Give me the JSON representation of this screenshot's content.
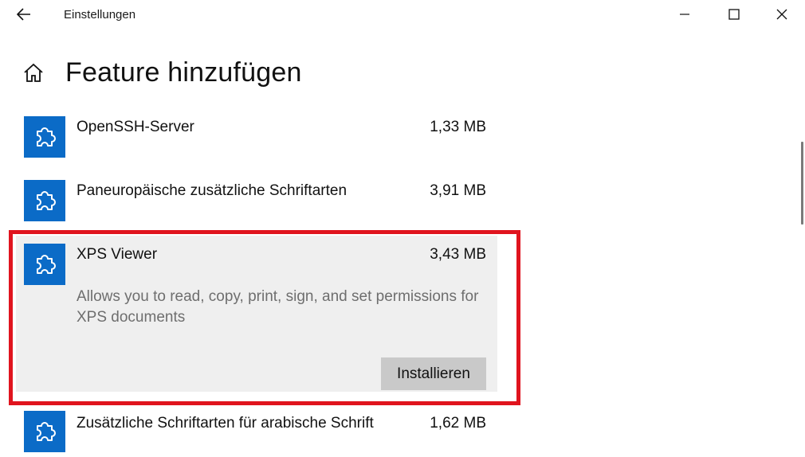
{
  "window": {
    "title": "Einstellungen"
  },
  "page": {
    "title": "Feature hinzufügen"
  },
  "colors": {
    "accent": "#0b6bc7",
    "highlight_border": "#e0141e",
    "selected_background": "#efefef",
    "button_background": "#c9c9c9",
    "description_text": "#6e6e6e"
  },
  "icons": {
    "back": "arrow-left",
    "minimize": "minimize",
    "maximize": "maximize",
    "close": "close",
    "home": "home",
    "feature": "puzzle-piece"
  },
  "features": [
    {
      "name": "OpenSSH-Server",
      "size": "1,33 MB"
    },
    {
      "name": "Paneuropäische zusätzliche Schriftarten",
      "size": "3,91 MB"
    },
    {
      "name": "XPS Viewer",
      "size": "3,43 MB",
      "description": "Allows you to read, copy, print, sign, and set permissions for XPS documents",
      "install_label": "Installieren",
      "expanded": true
    },
    {
      "name": "Zusätzliche Schriftarten für arabische Schrift",
      "size": "1,62 MB"
    }
  ]
}
